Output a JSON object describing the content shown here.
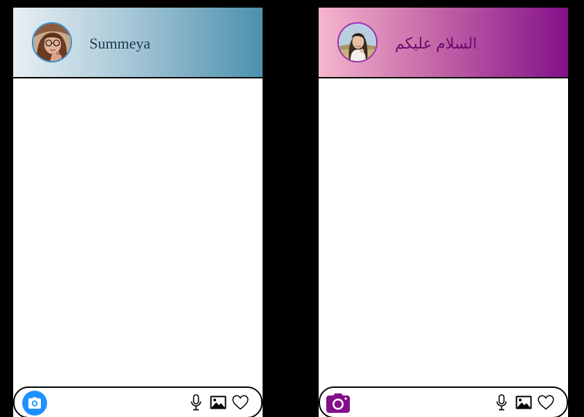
{
  "chats": [
    {
      "contact_name": "Summeya",
      "theme": {
        "header_gradient": [
          "#e8eff3",
          "#a9c9d8",
          "#4b91ae"
        ],
        "avatar_ring": "#3b8fd0",
        "camera_button": "#1e90ff",
        "name_color": "#1a3a4e"
      },
      "icons": [
        "camera-icon",
        "microphone-icon",
        "image-icon",
        "heart-icon"
      ]
    },
    {
      "contact_name": "السلام علیکم",
      "theme": {
        "header_gradient": [
          "#f6b6cc",
          "#c569a8",
          "#83108a"
        ],
        "avatar_ring": "#9a2fb2",
        "camera_button": "#83108a",
        "name_color": "#6b0a6e"
      },
      "icons": [
        "camera-icon",
        "microphone-icon",
        "image-icon",
        "heart-icon"
      ]
    }
  ]
}
